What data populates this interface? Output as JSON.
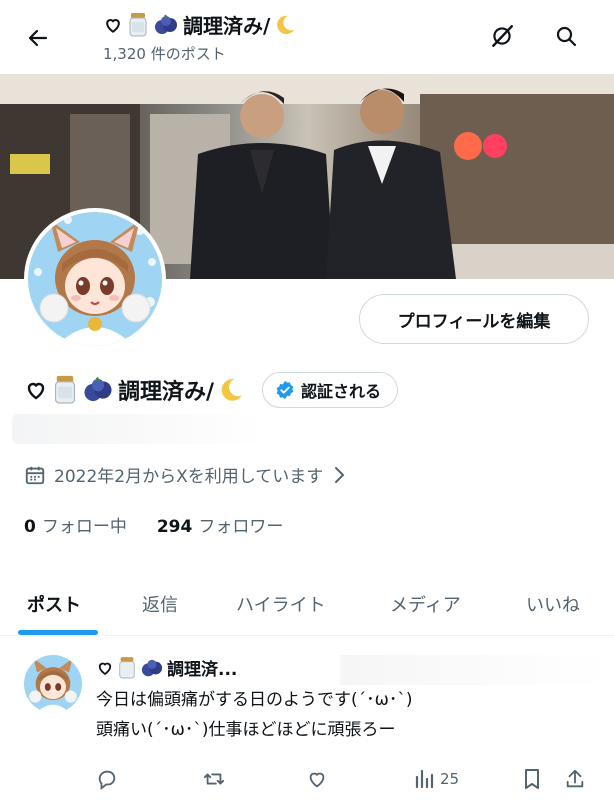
{
  "header": {
    "title": "調理済み/",
    "post_count": "1,320 件のポスト"
  },
  "profile": {
    "name": "調理済み/",
    "edit_button": "プロフィールを編集",
    "verify_button": "認証される",
    "joined": "2022年2月からXを利用しています",
    "following_count": "0",
    "following_label": "フォロー中",
    "followers_count": "294",
    "followers_label": "フォロワー"
  },
  "tabs": [
    "ポスト",
    "返信",
    "ハイライト",
    "メディア",
    "いいね"
  ],
  "tweet": {
    "author": "調理済...",
    "line1": "今日は偏頭痛がする日のようです(´･ω･`)",
    "line2": "頭痛い(´･ω･`)仕事ほどほどに頑張ろー",
    "views": "25"
  },
  "colors": {
    "accent": "#1d9bf0",
    "text": "#0f1419",
    "muted": "#536471",
    "border": "#cfd9de"
  },
  "icons": [
    "back-arrow-icon",
    "grok-icon",
    "search-icon",
    "heart-icon",
    "jar-icon",
    "blueberry-icon",
    "moon-icon",
    "verified-badge-icon",
    "calendar-icon",
    "chevron-right-icon",
    "reply-icon",
    "retweet-icon",
    "like-icon",
    "views-icon",
    "bookmark-icon",
    "share-icon"
  ]
}
